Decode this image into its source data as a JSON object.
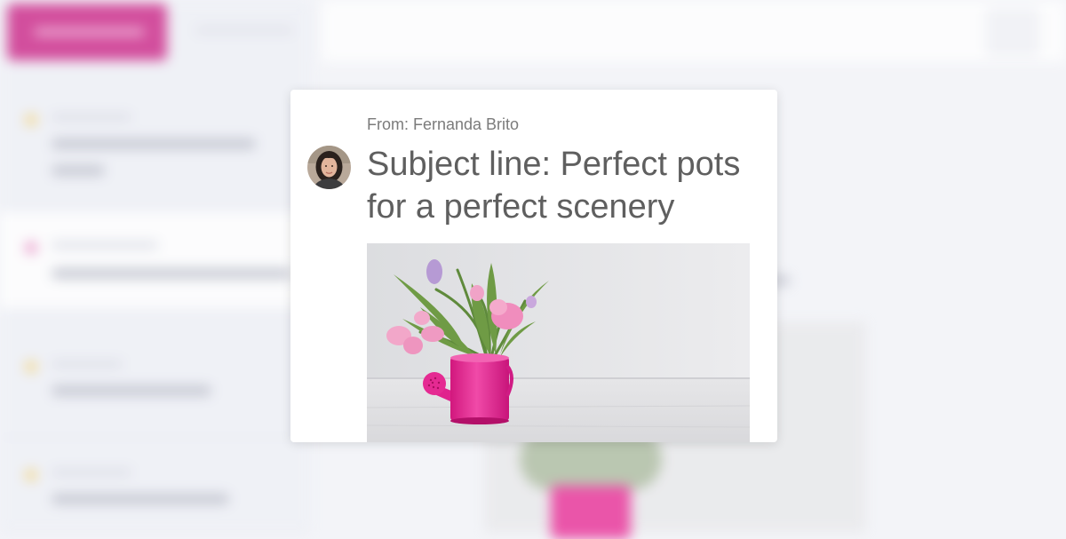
{
  "email": {
    "from": "From: Fernanda Brito",
    "subject": "Subject line: Perfect pots for a perfect scenery",
    "avatar_icon": "sender-avatar",
    "image_icon": "tulips-watering-can-image"
  },
  "colors": {
    "accent": "#c8177f",
    "pot_pink": "#e8208f",
    "text_gray": "#5f5f5f",
    "from_gray": "#7b7b7b"
  }
}
